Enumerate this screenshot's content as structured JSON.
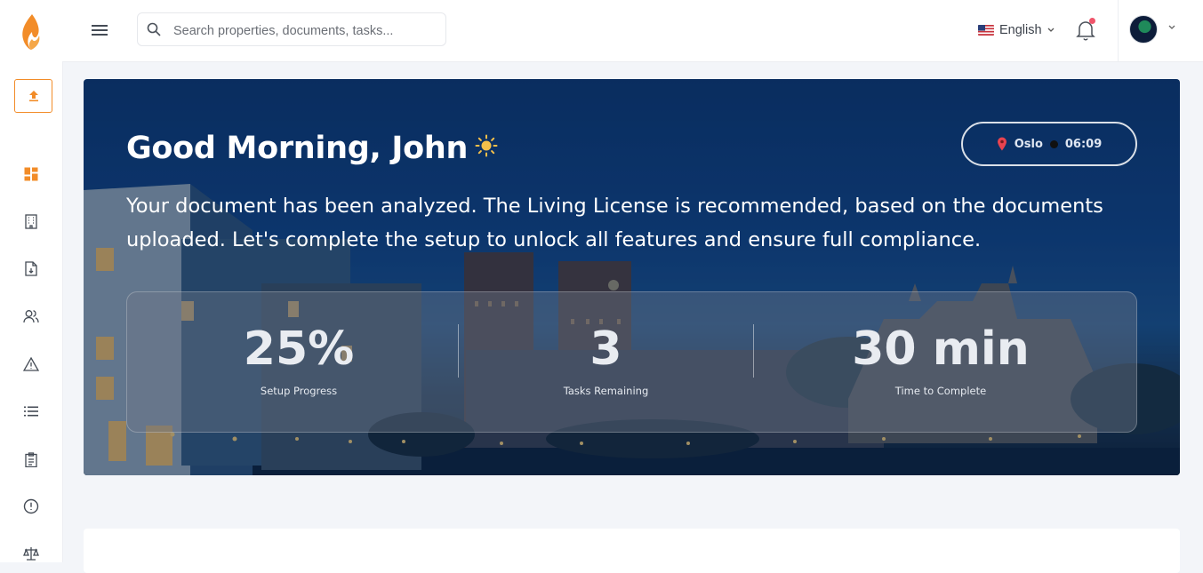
{
  "topbar": {
    "search_placeholder": "Search properties, documents, tasks...",
    "language": "English",
    "notification_dot": "#f0556b"
  },
  "sidebar": {
    "accent": "#f28c28",
    "items": [
      {
        "icon": "dashboard-icon",
        "active": true
      },
      {
        "icon": "building-icon",
        "active": false
      },
      {
        "icon": "document-icon",
        "active": false
      },
      {
        "icon": "users-icon",
        "active": false
      },
      {
        "icon": "warning-icon",
        "active": false
      },
      {
        "icon": "list-icon",
        "active": false
      },
      {
        "icon": "clipboard-icon",
        "active": false
      },
      {
        "icon": "alert-circle-icon",
        "active": false
      },
      {
        "icon": "scale-icon",
        "active": false
      }
    ]
  },
  "hero": {
    "greeting": "Good Morning, John",
    "location": "Oslo",
    "time": "06:09",
    "message": "Your document has been analyzed. The Living License is recommended, based on the documents uploaded. Let's complete the setup to unlock all features and ensure full compliance.",
    "stats": [
      {
        "value": "25%",
        "label": "Setup Progress"
      },
      {
        "value": "3",
        "label": "Tasks Remaining"
      },
      {
        "value": "30 min",
        "label": "Time to Complete"
      }
    ]
  }
}
